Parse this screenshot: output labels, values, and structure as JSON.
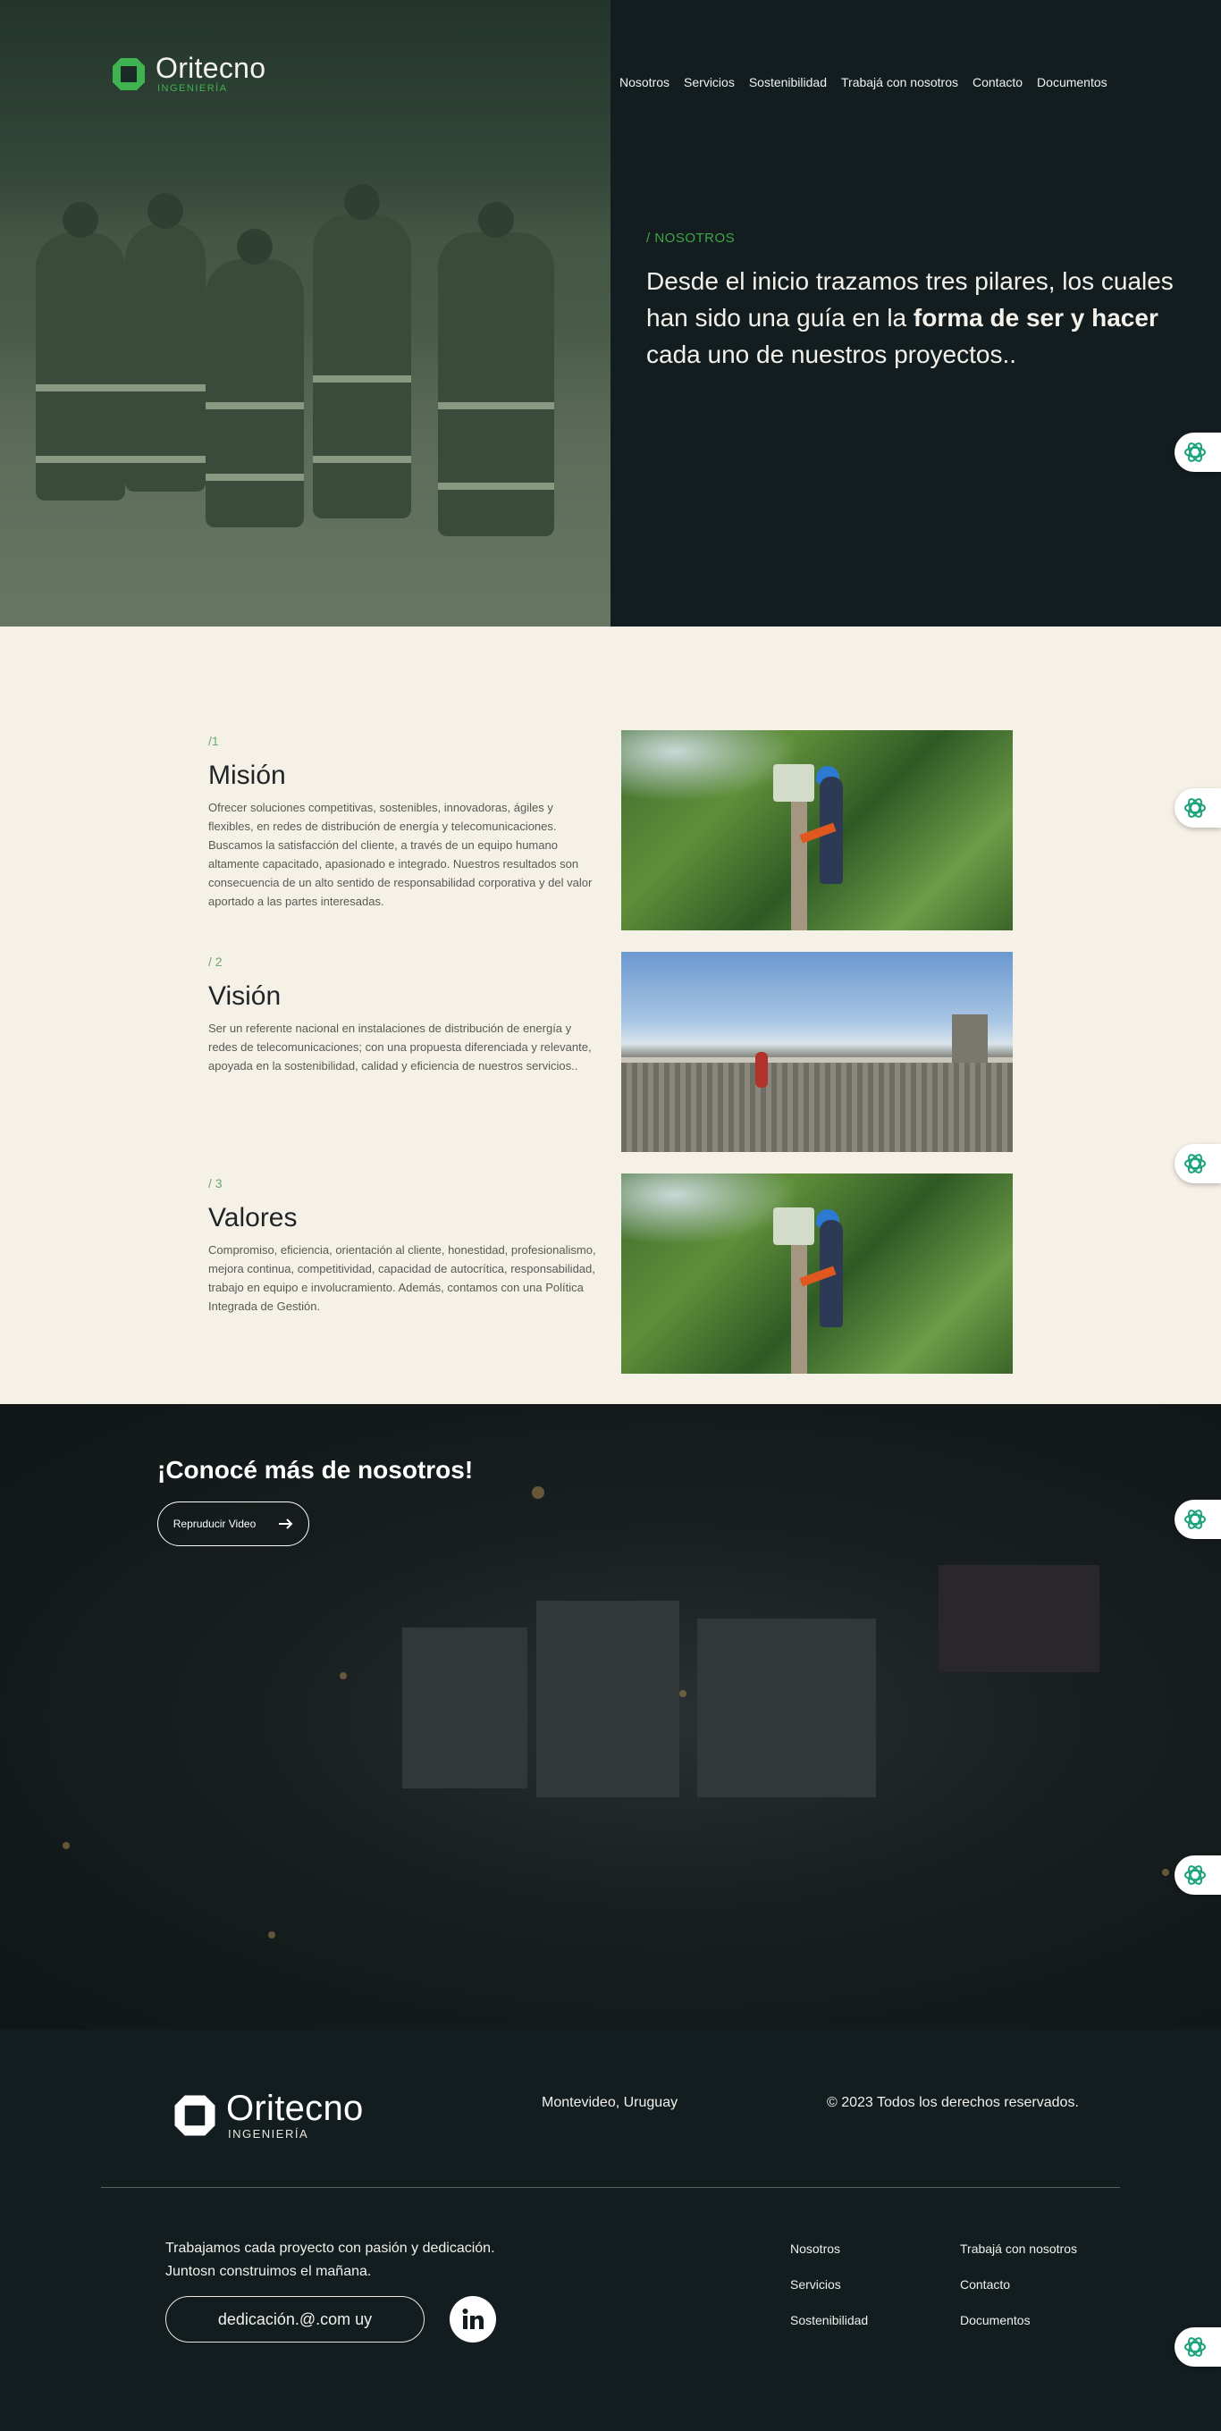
{
  "brand": {
    "name": "Oritecno",
    "sub": "INGENIERÍA"
  },
  "nav": {
    "items": [
      "Nosotros",
      "Servicios",
      "Sostenibilidad",
      "Trabajá con nosotros",
      "Contacto",
      "Documentos"
    ]
  },
  "hero": {
    "kicker": "/ NOSOTROS",
    "lead_1": "Desde el inicio trazamos tres pilares, los cuales han sido una guía en la ",
    "lead_bold": "forma de ser y hacer",
    "lead_2": " cada uno de nuestros proyectos.."
  },
  "pillars": [
    {
      "num": "/1",
      "title": "Misión",
      "text": "Ofrecer soluciones competitivas, sostenibles, innovadoras, ágiles y flexibles, en redes de distribución de energía y telecomunicaciones. Buscamos la satisfacción del cliente, a través de un equipo humano altamente capacitado, apasionado e integrado. Nuestros resultados son consecuencia de un alto sentido de responsabilidad corporativa y del valor aportado a las partes interesadas."
    },
    {
      "num": "/ 2",
      "title": "Visión",
      "text": "Ser un referente nacional en instalaciones de distribución de energía y redes de telecomunicaciones; con una propuesta diferenciada y relevante, apoyada en la sostenibilidad, calidad y eficiencia de nuestros servicios.."
    },
    {
      "num": "/ 3",
      "title": "Valores",
      "text": "Compromiso, eficiencia, orientación al cliente, honestidad, profesionalismo, mejora continua, competitividad, capacidad de autocrítica, responsabilidad, trabajo en equipo e involucramiento. Además, contamos con una Política Integrada de Gestión."
    }
  ],
  "video": {
    "title": "¡Conocé más de nosotros!",
    "button": "Repruducir Video",
    "button_icon": "arrow-right-icon"
  },
  "footer": {
    "location": "Montevideo, Uruguay",
    "copyright": "© 2023 Todos los derechos reservados.",
    "tagline_1": "Trabajamos cada proyecto con pasión y dedicación.",
    "tagline_2": "Juntosn construimos el mañana.",
    "email": "dedicación.@.com uy",
    "social_icon": "linkedin-icon",
    "links": [
      "Nosotros",
      "Trabajá con nosotros",
      "Servicios",
      "Contacto",
      "Sostenibilidad",
      "Documentos"
    ]
  },
  "colors": {
    "accent": "#3fb34f",
    "dark": "#131d20",
    "cream": "#f6f1e7",
    "badge_icon": "#1aa37a"
  }
}
